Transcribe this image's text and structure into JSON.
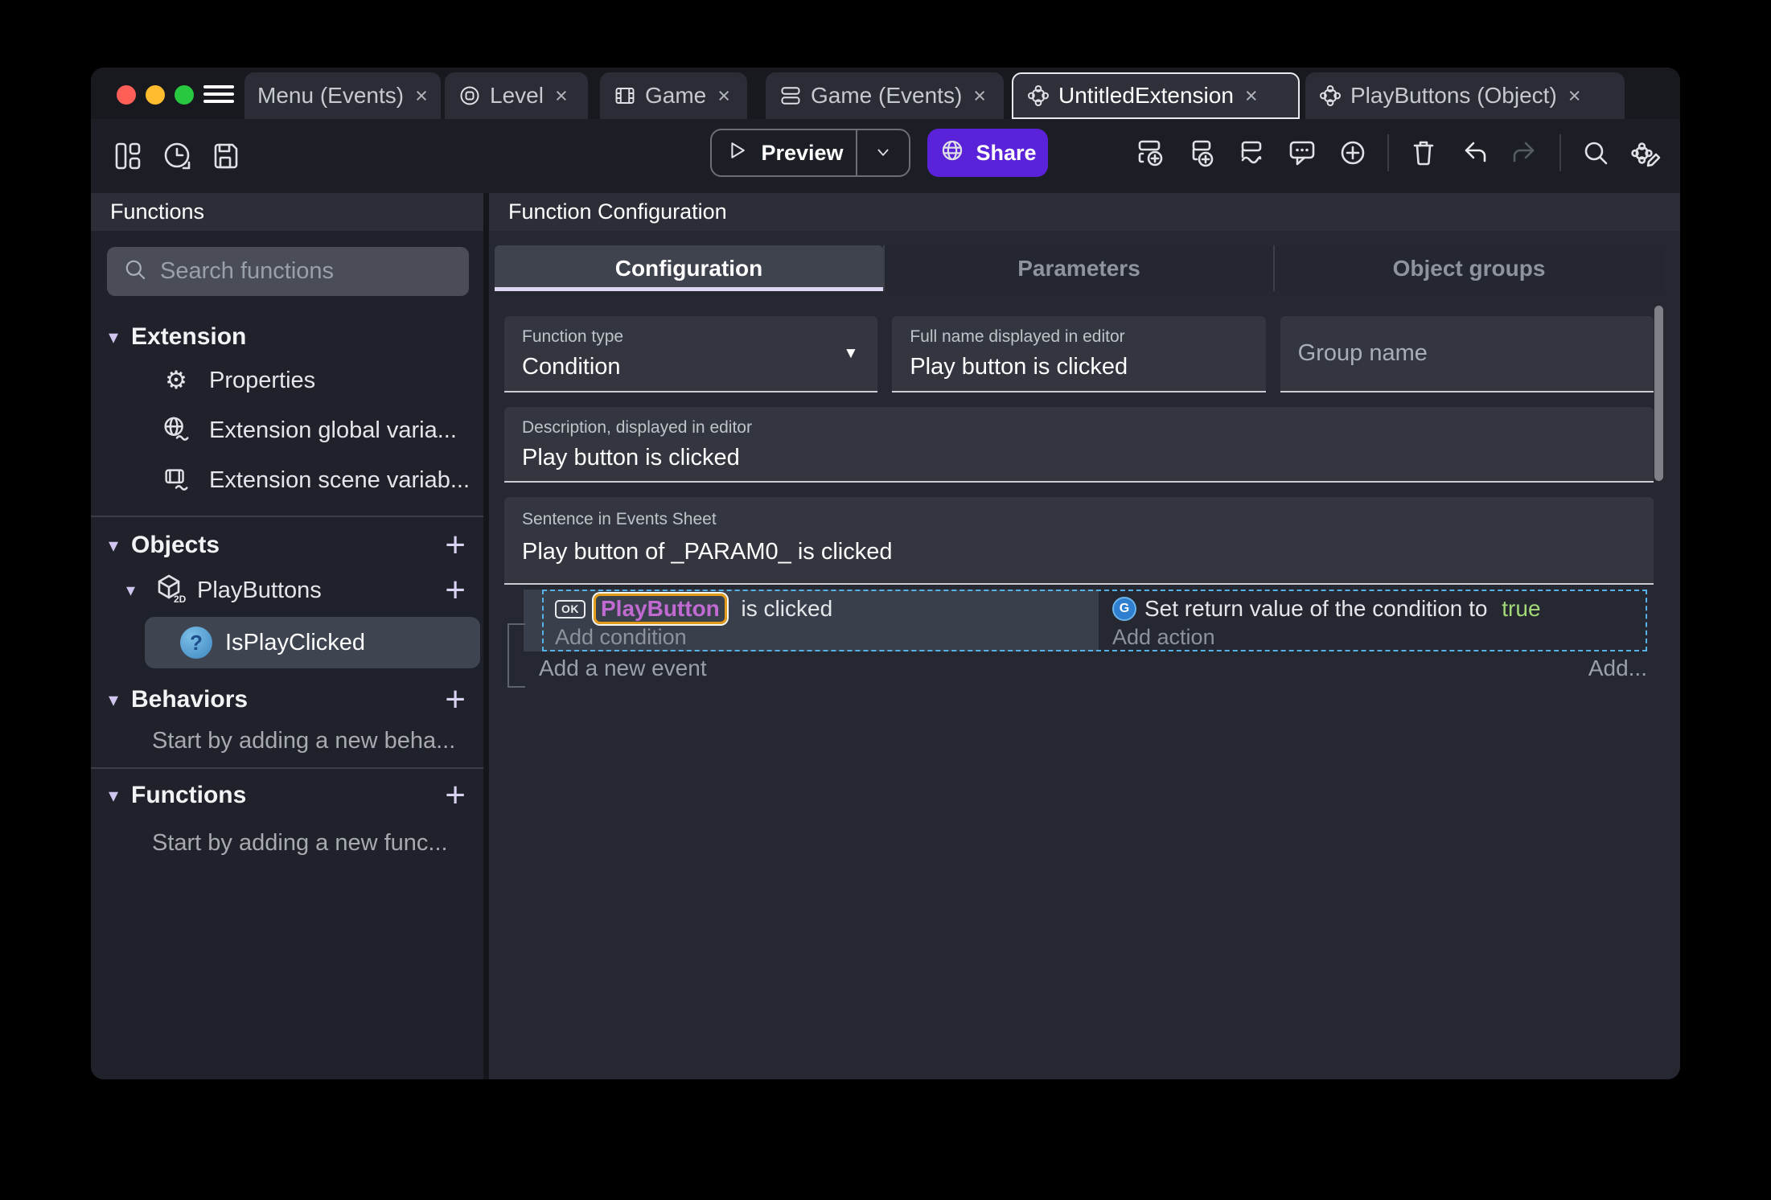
{
  "glyphs": {
    "triangle": "▾",
    "plus": "+",
    "close": "×",
    "dropdown": "▼",
    "gear": "⚙"
  },
  "colors": {
    "accent_purple": "#5b23d9",
    "selection_blue": "#57b2e8",
    "object_highlight_border": "#e09c1a",
    "object_name_purple": "#c06ad2",
    "true_green": "#a3d977",
    "traffic_red": "#ff5f57",
    "traffic_yellow": "#febc2e",
    "traffic_green": "#28c840"
  },
  "titlebar": {
    "tabs": [
      {
        "label": "Menu (Events)"
      },
      {
        "label": "Level"
      },
      {
        "label": "Game"
      },
      {
        "label": "Game (Events)"
      },
      {
        "label": "UntitledExtension"
      },
      {
        "label": "PlayButtons (Object)"
      }
    ]
  },
  "toolbar": {
    "preview_label": "Preview",
    "share_label": "Share"
  },
  "sidebar": {
    "title": "Functions",
    "search_placeholder": "Search functions",
    "extension_section": {
      "label": "Extension",
      "items": [
        {
          "label": "Properties"
        },
        {
          "label": "Extension global varia..."
        },
        {
          "label": "Extension scene variab..."
        }
      ]
    },
    "objects_section": {
      "label": "Objects",
      "object": {
        "label": "PlayButtons",
        "badge": "2D"
      },
      "function": {
        "label": "IsPlayClicked",
        "glyph": "?"
      }
    },
    "behaviors_section": {
      "label": "Behaviors",
      "empty": "Start by adding a new beha..."
    },
    "functions_section": {
      "label": "Functions",
      "empty": "Start by adding a new func..."
    }
  },
  "main": {
    "title": "Function Configuration",
    "tabs": [
      {
        "label": "Configuration"
      },
      {
        "label": "Parameters"
      },
      {
        "label": "Object groups"
      }
    ],
    "fields": {
      "function_type": {
        "label": "Function type",
        "value": "Condition"
      },
      "full_name": {
        "label": "Full name displayed in editor",
        "value": "Play button is clicked"
      },
      "group_name": {
        "placeholder": "Group name"
      },
      "description": {
        "label": "Description, displayed in editor",
        "value": "Play button is clicked"
      },
      "sentence": {
        "label": "Sentence in Events Sheet",
        "value": "Play button of _PARAM0_ is clicked"
      }
    },
    "events": {
      "condition": {
        "icon_glyph": "OK",
        "object": "PlayButton",
        "text": " is clicked"
      },
      "add_condition": "Add condition",
      "action": {
        "icon_glyph": "G",
        "text": "Set return value of the condition to ",
        "value": "true"
      },
      "add_action": "Add action",
      "add_new_event": "Add a new event",
      "add_more": "Add..."
    }
  }
}
